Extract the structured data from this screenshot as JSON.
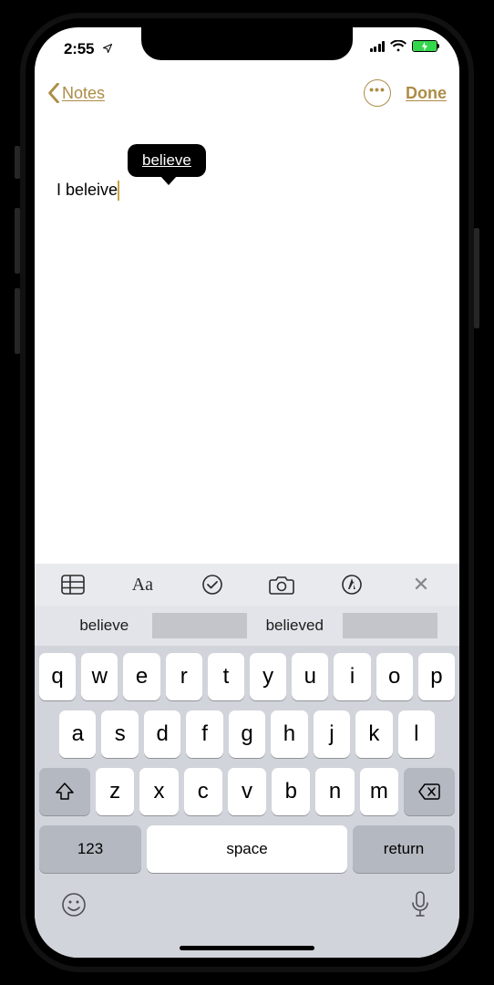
{
  "status": {
    "time": "2:55"
  },
  "nav": {
    "back_label": "Notes",
    "done_label": "Done"
  },
  "autocorrect": {
    "suggestion": "believe"
  },
  "note": {
    "text": "I beleive"
  },
  "suggestions": {
    "left": "believe",
    "right": "believed"
  },
  "keyboard": {
    "row1": [
      "q",
      "w",
      "e",
      "r",
      "t",
      "y",
      "u",
      "i",
      "o",
      "p"
    ],
    "row2": [
      "a",
      "s",
      "d",
      "f",
      "g",
      "h",
      "j",
      "k",
      "l"
    ],
    "row3": [
      "z",
      "x",
      "c",
      "v",
      "b",
      "n",
      "m"
    ],
    "numbers_label": "123",
    "space_label": "space",
    "return_label": "return"
  },
  "colors": {
    "accent": "#ad8c46"
  }
}
